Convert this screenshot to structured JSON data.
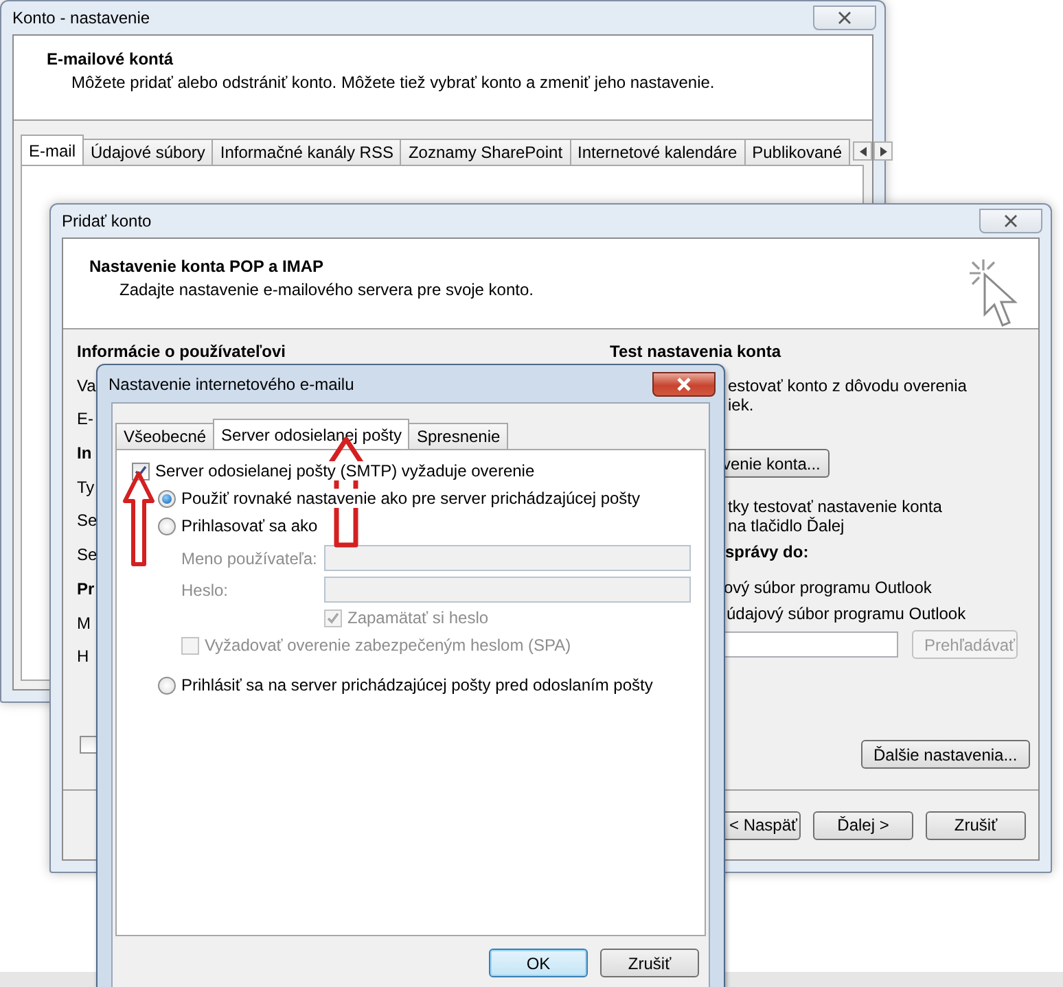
{
  "account_settings": {
    "title": "Konto - nastavenie",
    "heading": "E-mailové kontá",
    "description": "Môžete pridať alebo odstrániť konto. Môžete tiež vybrať konto a zmeniť jeho nastavenie.",
    "tabs": [
      {
        "label": "E-mail",
        "selected": true
      },
      {
        "label": "Údajové súbory",
        "selected": false
      },
      {
        "label": "Informačné kanály RSS",
        "selected": false
      },
      {
        "label": "Zoznamy SharePoint",
        "selected": false
      },
      {
        "label": "Internetové kalendáre",
        "selected": false
      },
      {
        "label": "Publikované",
        "selected": false
      }
    ]
  },
  "add_account": {
    "title": "Pridať konto",
    "heading": "Nastavenie konta POP a IMAP",
    "description": "Zadajte nastavenie e-mailového servera pre svoje konto.",
    "left_column": [
      {
        "text": "Informácie o používateľovi",
        "kind": "heading"
      },
      {
        "text": "Va",
        "kind": "label"
      },
      {
        "text": "E-",
        "kind": "label"
      },
      {
        "text": "In",
        "kind": "heading"
      },
      {
        "text": "Ty",
        "kind": "label"
      },
      {
        "text": "Se",
        "kind": "label"
      },
      {
        "text": "Se",
        "kind": "label"
      },
      {
        "text": "Pr",
        "kind": "heading"
      },
      {
        "text": "M",
        "kind": "label"
      },
      {
        "text": "H",
        "kind": "label"
      }
    ],
    "left_checkbox": {
      "checked": false
    },
    "test_heading": "Test nastavenia konta",
    "test_text": [
      "estovať konto z dôvodu overenia",
      "iek."
    ],
    "test_button": "venie konta...",
    "auto_text": [
      "tky testovať nastavenie konta",
      "na tlačidlo Ďalej"
    ],
    "deliver_heading": "správy do:",
    "deliver_options": [
      "ový súbor programu Outlook",
      "údajový súbor programu Outlook"
    ],
    "browse_button": {
      "label": "Prehľadávať",
      "disabled": true
    },
    "more_button": "Ďalšie nastavenia...",
    "footer_buttons": [
      "< Naspäť",
      "Ďalej >",
      "Zrušiť"
    ]
  },
  "internet_email": {
    "title": "Nastavenie internetového e-mailu",
    "tabs": [
      {
        "label": "Všeobecné",
        "selected": false
      },
      {
        "label": "Server odosielanej pošty",
        "selected": true
      },
      {
        "label": "Spresnenie",
        "selected": false
      }
    ],
    "smtp_auth": {
      "label": "Server odosielanej pošty (SMTP) vyžaduje overenie",
      "checked": true
    },
    "auth_options": [
      {
        "label": "Použiť rovnaké nastavenie ako pre server prichádzajúcej pošty",
        "selected": true
      },
      {
        "label": "Prihlasovať sa ako",
        "selected": false
      }
    ],
    "login_fields": [
      {
        "label": "Meno používateľa:",
        "disabled": true
      },
      {
        "label": "Heslo:",
        "disabled": true
      }
    ],
    "remember_password": {
      "label": "Zapamätať si heslo",
      "checked": true,
      "disabled": true
    },
    "spa": {
      "label": "Vyžadovať overenie zabezpečeným heslom (SPA)",
      "checked": false,
      "disabled": true
    },
    "login_before_send": {
      "label": "Prihlásiť sa na server prichádzajúcej pošty pred odoslaním pošty",
      "selected": false
    },
    "buttons": [
      {
        "label": "OK",
        "default": true
      },
      {
        "label": "Zrušiť",
        "default": false
      }
    ]
  }
}
